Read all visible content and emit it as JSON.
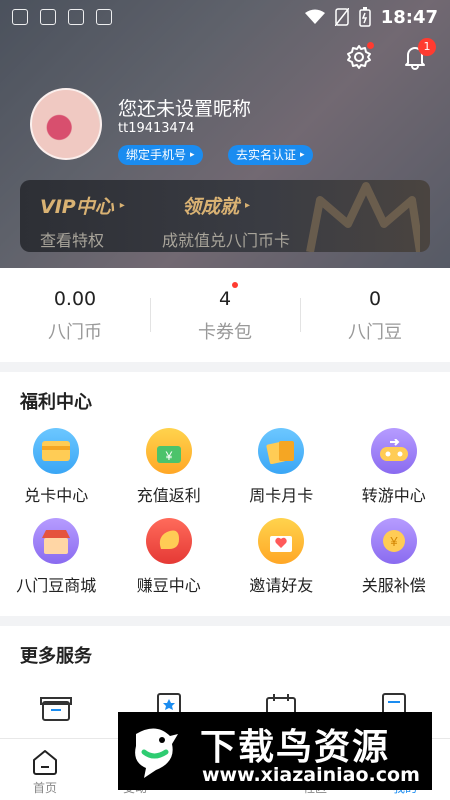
{
  "status_bar": {
    "time": "18:47"
  },
  "header": {
    "nickname": "您还未设置昵称",
    "user_id": "tt19413474",
    "bind_phone": "绑定手机号",
    "real_name": "去实名认证",
    "notification_count": "1"
  },
  "vip": {
    "title": "VIP中心",
    "subtitle": "查看特权",
    "achieve_title": "领成就",
    "achieve_subtitle": "成就值兑八门币卡"
  },
  "stats": [
    {
      "value": "0.00",
      "label": "八门币"
    },
    {
      "value": "4",
      "label": "卡券包"
    },
    {
      "value": "0",
      "label": "八门豆"
    }
  ],
  "welfare": {
    "title": "福利中心",
    "items": [
      {
        "label": "兑卡中心",
        "icon": "card-exchange-icon"
      },
      {
        "label": "充值返利",
        "icon": "recharge-rebate-icon"
      },
      {
        "label": "周卡月卡",
        "icon": "weekly-monthly-card-icon"
      },
      {
        "label": "转游中心",
        "icon": "game-transfer-icon"
      },
      {
        "label": "八门豆商城",
        "icon": "bean-mall-icon"
      },
      {
        "label": "赚豆中心",
        "icon": "earn-beans-icon"
      },
      {
        "label": "邀请好友",
        "icon": "invite-friends-icon"
      },
      {
        "label": "关服补偿",
        "icon": "compensation-icon"
      }
    ]
  },
  "more": {
    "title": "更多服务"
  },
  "tabs": [
    {
      "label": "首页"
    },
    {
      "label": "变动"
    },
    {
      "label": "MOD"
    },
    {
      "label": "社区"
    },
    {
      "label": "我的"
    }
  ],
  "watermark": {
    "text": "下载鸟资源",
    "url": "www.xiazainiao.com"
  },
  "colors": {
    "accent_blue": "#1a8cf0",
    "badge_red": "#ff3b30",
    "vip_gold": "#d9b273"
  }
}
